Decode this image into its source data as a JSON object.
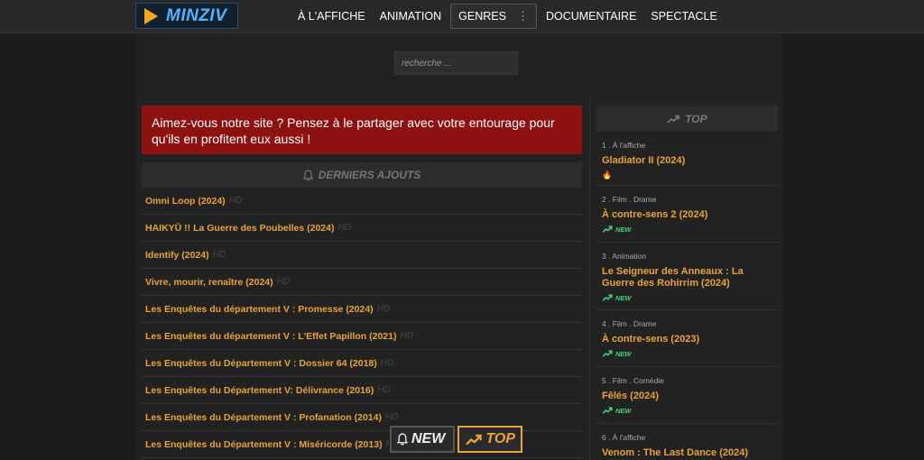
{
  "header": {
    "logo_text": "MINZIV",
    "nav": [
      {
        "label": "À L'AFFICHE"
      },
      {
        "label": "ANIMATION"
      },
      {
        "label": "GENRES"
      },
      {
        "label": "DOCUMENTAIRE"
      },
      {
        "label": "SPECTACLE"
      }
    ]
  },
  "search": {
    "placeholder": "recherche ..."
  },
  "banner": {
    "text": "Aimez-vous notre site ? Pensez à le partager avec votre entourage pour qu'ils en profitent eux aussi !"
  },
  "latest": {
    "heading": "DERNIERS AJOUTS",
    "quality_tag": "HD",
    "items": [
      {
        "title": "Omni Loop (2024)"
      },
      {
        "title": "HAIKYŪ !! La Guerre des Poubelles (2024)"
      },
      {
        "title": "Identify (2024)"
      },
      {
        "title": "Vivre, mourir, renaître (2024)"
      },
      {
        "title": "Les Enquêtes du département V : Promesse (2024)"
      },
      {
        "title": "Les Enquêtes du département V : L'Effet Papillon (2021)"
      },
      {
        "title": "Les Enquêtes du Département V : Dossier 64 (2018)"
      },
      {
        "title": "Les Enquêtes du Département V: Délivrance (2016)"
      },
      {
        "title": "Les Enquêtes du Département V : Profanation (2014)"
      },
      {
        "title": "Les Enquêtes du Département V : Miséricorde (2013)"
      }
    ]
  },
  "top": {
    "heading": "TOP",
    "items": [
      {
        "meta": "1 . À l'affiche",
        "title": "Gladiator II (2024)",
        "badge": "fire"
      },
      {
        "meta": "2 . Film . Drame",
        "title": "À contre-sens 2 (2024)",
        "badge": "NEW"
      },
      {
        "meta": "3 . Animation",
        "title": "Le Seigneur des Anneaux : La Guerre des Rohirrim (2024)",
        "badge": "NEW"
      },
      {
        "meta": "4 . Film . Drame",
        "title": "À contre-sens (2023)",
        "badge": "NEW"
      },
      {
        "meta": "5 . Film . Comédie",
        "title": "Fêlés (2024)",
        "badge": "NEW"
      },
      {
        "meta": "6 . À l'affiche",
        "title": "Venom : The Last Dance (2024)",
        "badge": ""
      }
    ]
  },
  "float_tabs": {
    "new_label": "NEW",
    "top_label": "TOP"
  },
  "colors": {
    "accent": "#e8a33a",
    "banner": "#8e1111",
    "new_badge": "#3fd37a",
    "logo_blue": "#4fb3ff"
  }
}
